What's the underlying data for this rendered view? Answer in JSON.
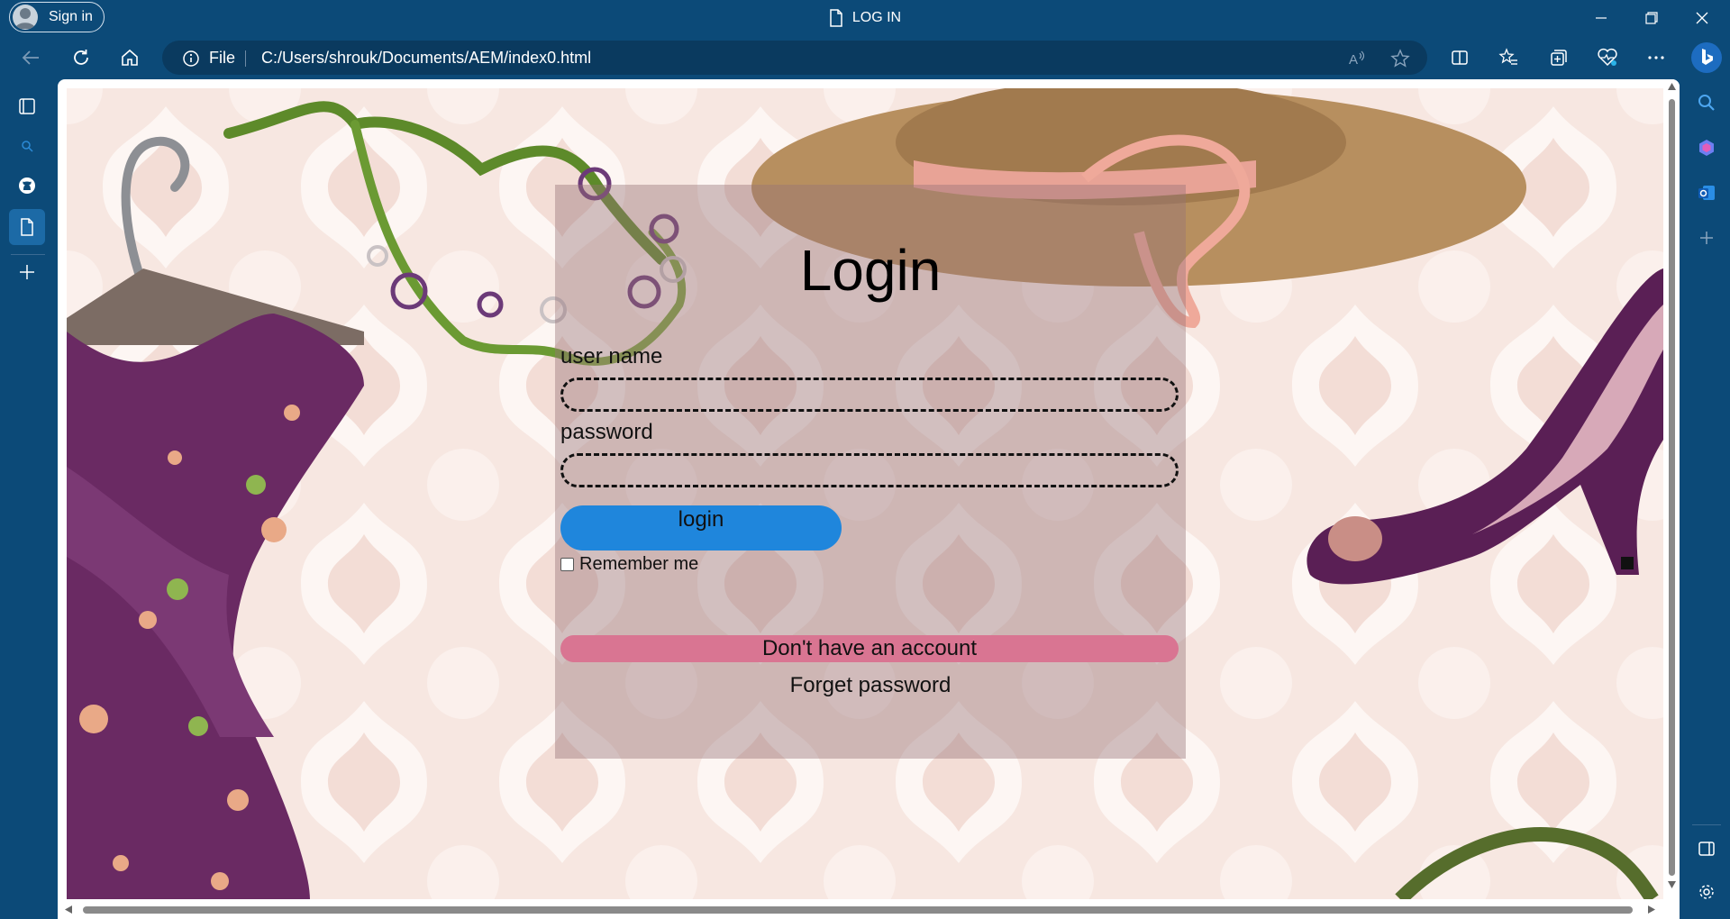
{
  "window": {
    "title": "LOG IN",
    "sign_in_label": "Sign in"
  },
  "toolbar": {
    "address_prefix": "File",
    "url": "C:/Users/shrouk/Documents/AEM/index0.html"
  },
  "page": {
    "login_title": "Login",
    "username_label": "user name",
    "username_value": "",
    "password_label": "password",
    "password_value": "",
    "login_button": "login",
    "remember_label": "Remember me",
    "remember_checked": false,
    "signup_button": "Don't have an account",
    "forget_link": "Forget password"
  },
  "colors": {
    "browser_chrome": "#0c4a78",
    "login_button": "#1f86dc",
    "signup_button": "#d97592",
    "login_panel_overlay": "rgba(150,115,118,0.42)"
  }
}
